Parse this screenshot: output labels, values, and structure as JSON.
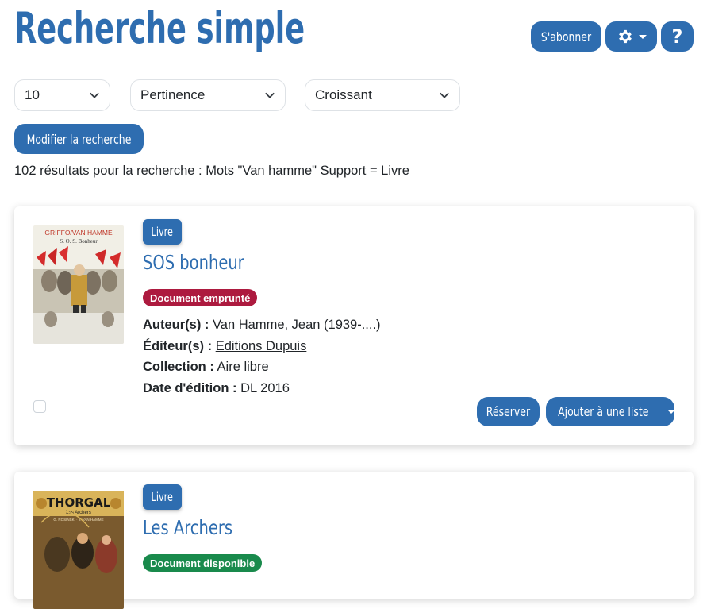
{
  "page": {
    "title": "Recherche simple"
  },
  "header_actions": {
    "subscribe_label": "S'abonner",
    "settings_icon": "gear-icon",
    "help_label": "?"
  },
  "filters": {
    "count": "10",
    "sort_by": "Pertinence",
    "order": "Croissant"
  },
  "modify_search_label": "Modifier la recherche",
  "results_summary": "102 résultats pour la recherche : Mots \"Van hamme\" Support = Livre",
  "results": [
    {
      "type": "Livre",
      "title": "SOS bonheur",
      "status": "Document emprunté",
      "status_color": "#ad1a3f",
      "author_label": "Auteur(s) :",
      "author": "Van Hamme, Jean (1939-....)",
      "publisher_label": "Éditeur(s) :",
      "publisher": "Editions Dupuis",
      "collection_label": "Collection :",
      "collection": "Aire libre",
      "date_label": "Date d'édition :",
      "date": "DL 2016",
      "cover_text": {
        "authors": "GRIFFO/VAN HAMME",
        "title": "S. O. S. Bonheur"
      },
      "reserve_label": "Réserver",
      "add_to_list_label": "Ajouter à une liste"
    },
    {
      "type": "Livre",
      "title": "Les Archers",
      "status": "Document disponible",
      "status_color": "#198a4c",
      "cover_text": {
        "series": "THORGAL",
        "title": "Les Archers",
        "authors": "G. ROSINSKI · J. VAN HAMME"
      }
    }
  ],
  "colors": {
    "primary": "#2e6db0",
    "text": "#212529"
  }
}
